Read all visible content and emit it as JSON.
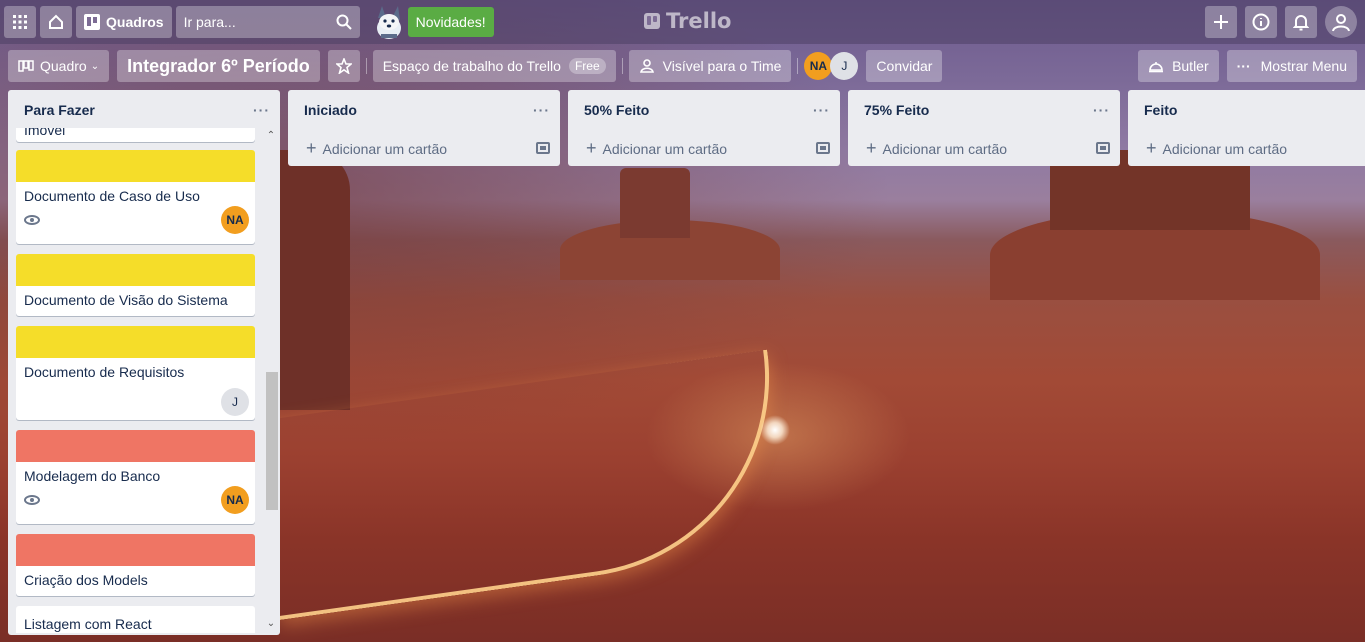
{
  "colors": {
    "label_yellow": "#f5dd29",
    "label_red": "#ef7564",
    "avatar_orange": "#f29e1f",
    "novidades_green": "#5aac44"
  },
  "header": {
    "apps_icon": "grid-icon",
    "home_icon": "home-icon",
    "boards_label": "Quadros",
    "search_placeholder": "Ir para...",
    "novidades_label": "Novidades!",
    "logo_text": "Trello",
    "right_icons": [
      "plus-icon",
      "info-icon",
      "bell-icon",
      "user-icon"
    ]
  },
  "board": {
    "view_label": "Quadro",
    "title": "Integrador 6º Período",
    "workspace_label": "Espaço de trabalho do Trello",
    "workspace_badge": "Free",
    "visibility_label": "Visível para o Time",
    "members": [
      "NA",
      "J"
    ],
    "invite_label": "Convidar",
    "butler_label": "Butler",
    "menu_label": "Mostrar Menu"
  },
  "lists": [
    {
      "title": "Para Fazer",
      "cards": [
        {
          "title": "Imóvel",
          "label": "",
          "avatar": ""
        },
        {
          "title": "Documento de Caso de Uso",
          "label": "yellow",
          "watch": true,
          "avatar": "NA"
        },
        {
          "title": "Documento de Visão do Sistema",
          "label": "yellow",
          "avatar": ""
        },
        {
          "title": "Documento de Requisitos",
          "label": "yellow",
          "avatar": "J"
        },
        {
          "title": "Modelagem do Banco",
          "label": "red",
          "watch": true,
          "avatar": "NA"
        },
        {
          "title": "Criação dos Models",
          "label": "red",
          "avatar": ""
        },
        {
          "title": "Listagem com React",
          "label": "",
          "avatar": ""
        }
      ]
    },
    {
      "title": "Iniciado",
      "add_label": "Adicionar um cartão"
    },
    {
      "title": "50% Feito",
      "add_label": "Adicionar um cartão"
    },
    {
      "title": "75% Feito",
      "add_label": "Adicionar um cartão"
    },
    {
      "title": "Feito",
      "add_label": "Adicionar um cartão"
    }
  ]
}
